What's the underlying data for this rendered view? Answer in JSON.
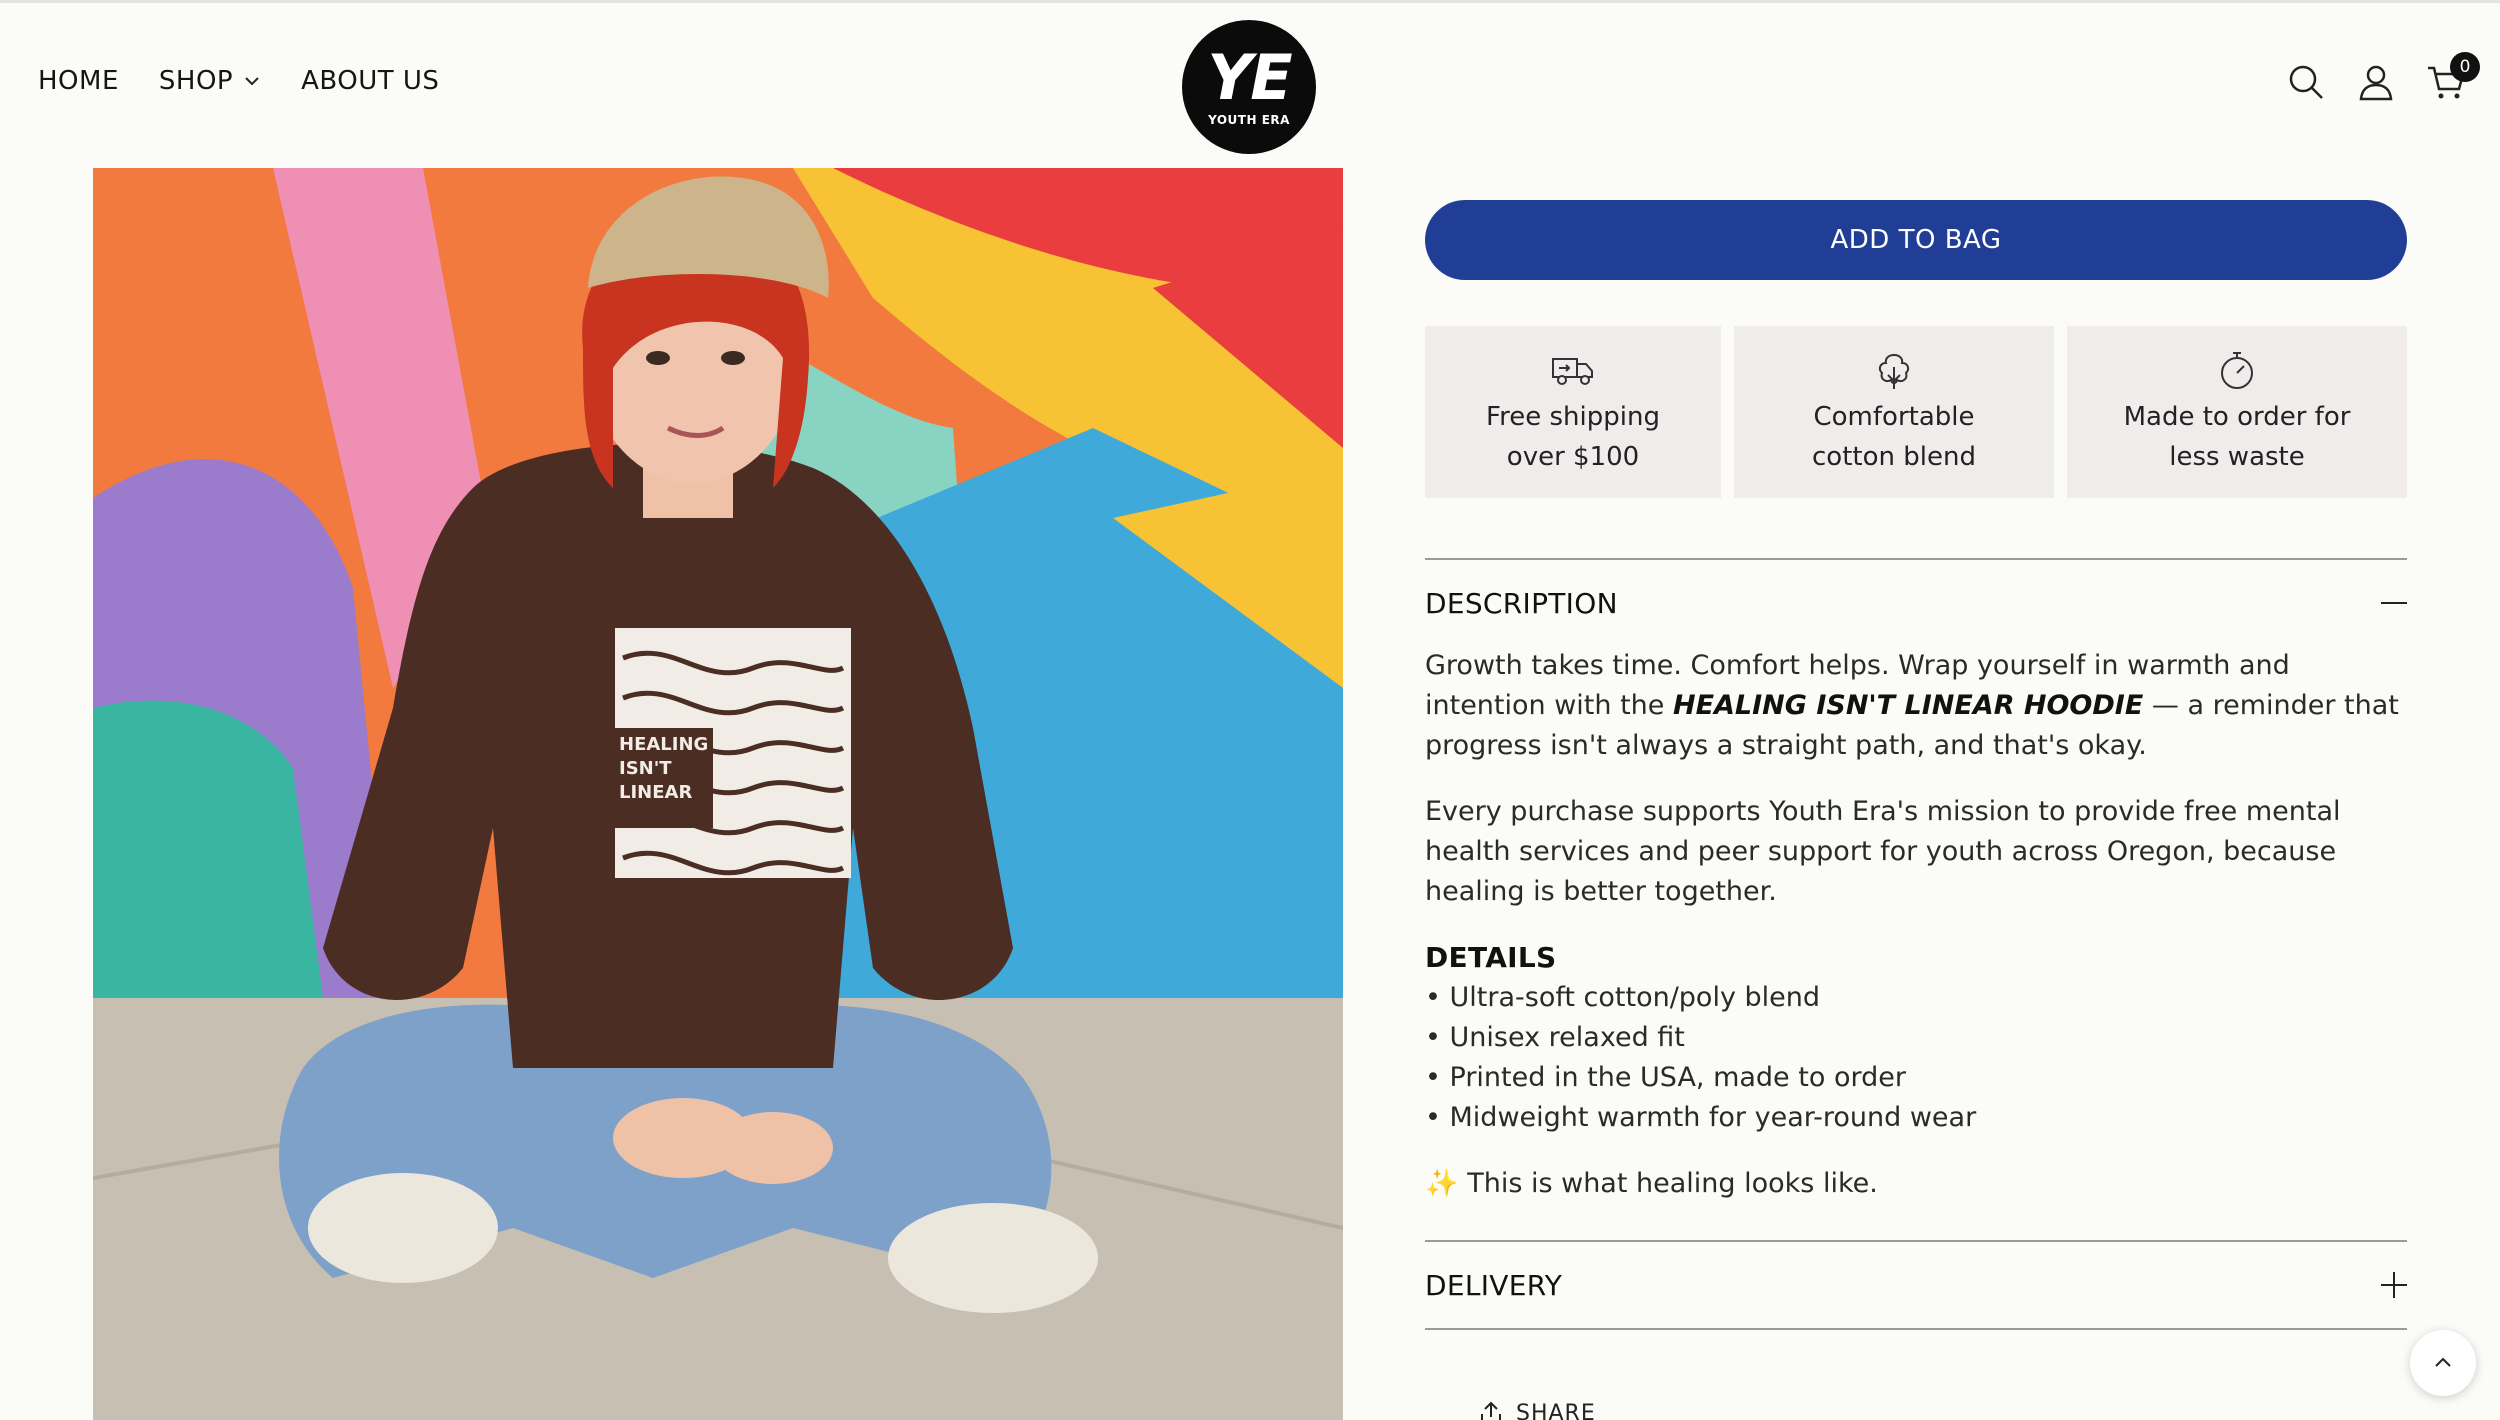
{
  "header": {
    "nav": [
      {
        "label": "HOME"
      },
      {
        "label": "SHOP"
      },
      {
        "label": "ABOUT US"
      }
    ],
    "logo": {
      "mark": "YE",
      "text": "YOUTH ERA"
    },
    "cart_count": "0",
    "icons": [
      "search-icon",
      "account-icon",
      "cart-icon"
    ]
  },
  "product": {
    "photo_print": [
      "HEALING",
      "ISN'T",
      "LINEAR"
    ],
    "add_to_bag": "ADD TO BAG",
    "features": [
      {
        "icon": "truck-icon",
        "line1": "Free shipping",
        "line2": "over $100"
      },
      {
        "icon": "cotton-icon",
        "line1": "Comfortable",
        "line2": "cotton blend"
      },
      {
        "icon": "stopwatch-icon",
        "line1": "Made to order for",
        "line2": "less waste"
      }
    ],
    "description": {
      "title": "DESCRIPTION",
      "p1_pre": "Growth takes time. Comfort helps. Wrap yourself in warmth and intention with the ",
      "p1_bold": "HEALING ISN'T LINEAR HOODIE",
      "p1_post": " — a reminder that progress isn't always a straight path, and that's okay.",
      "p2": "Every purchase supports Youth Era's mission to provide free mental health services and peer support for youth across Oregon, because healing is better together.",
      "details_title": "DETAILS",
      "details": [
        "• Ultra-soft cotton/poly blend",
        "• Unisex relaxed fit",
        "• Printed in the USA, made to order",
        "• Midweight warmth for year-round wear"
      ],
      "sparkle": "✨",
      "closing": " This is what healing looks like."
    },
    "delivery_title": "DELIVERY",
    "share": "SHARE"
  },
  "colors": {
    "accent": "#213e97",
    "feature_bg": "#f0ecec",
    "page_bg": "#fbfbf7"
  }
}
